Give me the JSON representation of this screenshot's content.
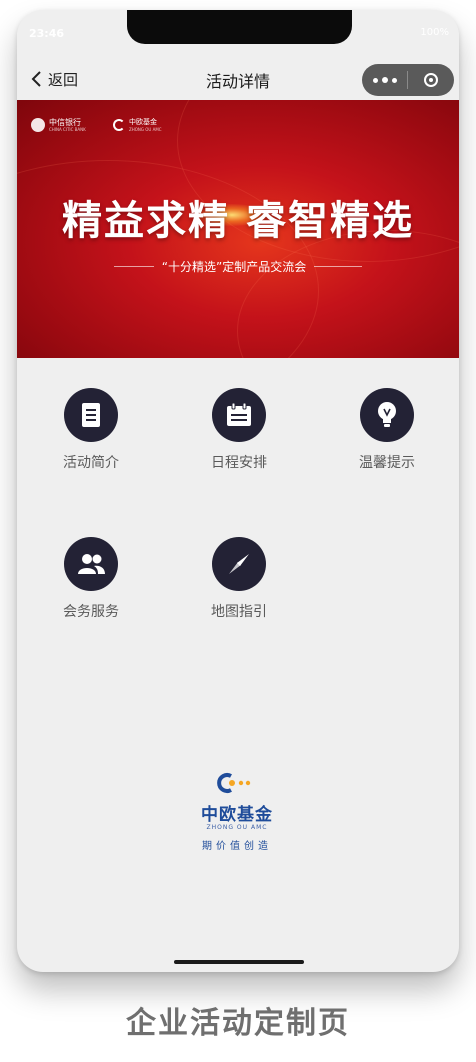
{
  "status_bar": {
    "time": "23:46",
    "battery": "100%"
  },
  "navbar": {
    "back_label": "返回",
    "title": "活动详情"
  },
  "banner": {
    "logo_bank": "中信银行",
    "logo_bank_sub": "CHINA CITIC BANK",
    "logo_fund": "中欧基金",
    "logo_fund_sub": "ZHONG OU AMC",
    "headline": "精益求精 睿智精选",
    "subtitle": "“十分精选”定制产品交流会"
  },
  "menu": [
    {
      "label": "活动简介",
      "icon": "document-icon"
    },
    {
      "label": "日程安排",
      "icon": "calendar-icon"
    },
    {
      "label": "温馨提示",
      "icon": "lightbulb-icon"
    },
    {
      "label": "会务服务",
      "icon": "users-icon"
    },
    {
      "label": "地图指引",
      "icon": "compass-icon"
    }
  ],
  "brand": {
    "name": "中欧基金",
    "pinyin": "ZHONG OU AMC",
    "slogan": "期价值创造"
  },
  "caption": "企业活动定制页",
  "colors": {
    "banner_red": "#c4121a",
    "icon_circle": "#232235",
    "brand_blue": "#1f4c9a",
    "brand_orange": "#f5a623"
  }
}
